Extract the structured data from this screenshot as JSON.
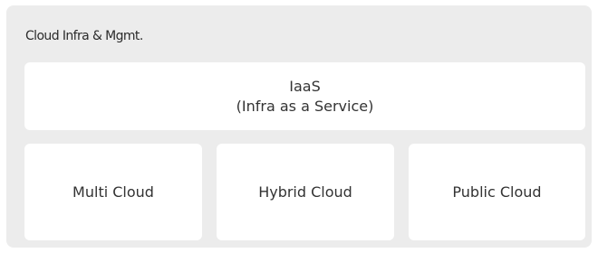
{
  "panel": {
    "title": "Cloud Infra & Mgmt."
  },
  "iaas": {
    "title": "IaaS",
    "subtitle": "(Infra as a Service)"
  },
  "clouds": [
    {
      "label": "Multi Cloud"
    },
    {
      "label": "Hybrid Cloud"
    },
    {
      "label": "Public Cloud"
    }
  ]
}
